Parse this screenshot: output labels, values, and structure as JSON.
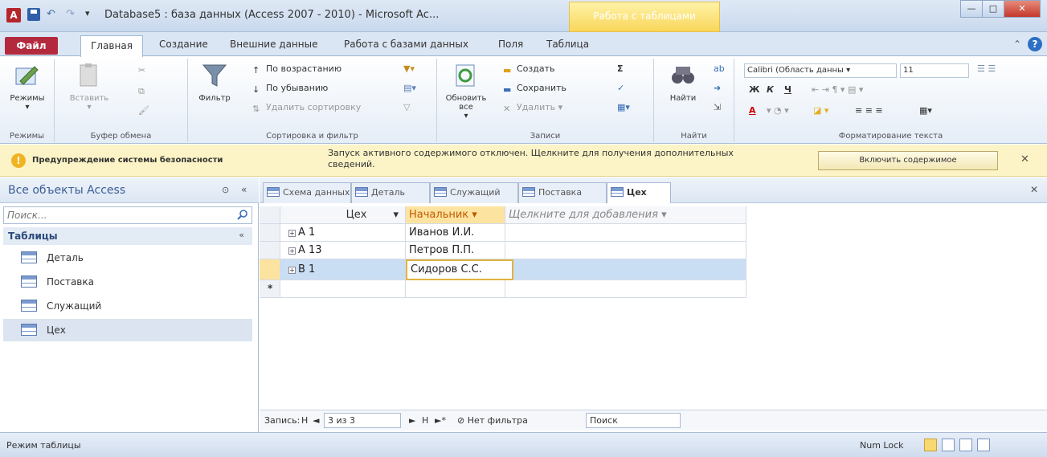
{
  "window": {
    "title": "Database5 : база данных (Access 2007 - 2010) - Microsoft Ac...",
    "context_group": "Работа с таблицами",
    "app_icon_letter": "A",
    "controls": {
      "minimize": "—",
      "maximize": "□",
      "close": "✕"
    }
  },
  "tabs": {
    "file": "Файл",
    "home": "Главная",
    "create": "Создание",
    "external": "Внешние данные",
    "dbtools": "Работа с базами данных",
    "fields": "Поля",
    "table": "Таблица"
  },
  "ribbon": {
    "views": {
      "button": "Режимы",
      "group": "Режимы"
    },
    "clipboard": {
      "paste": "Вставить",
      "group": "Буфер обмена"
    },
    "sort": {
      "filter": "Фильтр",
      "asc": "По возрастанию",
      "desc": "По убыванию",
      "clear": "Удалить сортировку",
      "group": "Сортировка и фильтр"
    },
    "records": {
      "refresh": "Обновить все",
      "new": "Создать",
      "save": "Сохранить",
      "delete": "Удалить",
      "totals": "Σ",
      "group": "Записи"
    },
    "find": {
      "find": "Найти",
      "group": "Найти"
    },
    "format": {
      "font": "Calibri (Область данны",
      "size": "11",
      "bold": "Ж",
      "italic": "К",
      "underline": "Ч",
      "font_color": "A",
      "group": "Форматирование текста"
    }
  },
  "security": {
    "title": "Предупреждение системы безопасности",
    "message": "Запуск активного содержимого отключен. Щелкните для получения дополнительных сведений.",
    "enable": "Включить содержимое",
    "close": "✕"
  },
  "nav": {
    "title": "Все объекты Access",
    "search_placeholder": "Поиск...",
    "group": "Таблицы",
    "items": [
      "Деталь",
      "Поставка",
      "Служащий",
      "Цех"
    ],
    "selected_index": 3
  },
  "doc_tabs": [
    "Схема данных",
    "Деталь",
    "Служащий",
    "Поставка",
    "Цех"
  ],
  "active_doc_tab": "Цех",
  "datasheet": {
    "columns": [
      "Цех",
      "Начальник",
      "Щелкните для добавления"
    ],
    "rows": [
      {
        "shop": "A 1",
        "chief": "Иванов И.И."
      },
      {
        "shop": "A 13",
        "chief": "Петров П.П."
      },
      {
        "shop": "B 1",
        "chief": "Сидоров С.С."
      }
    ],
    "new_row_marker": "*"
  },
  "record_nav": {
    "label": "Запись:",
    "first": "H",
    "prev": "◄",
    "position": "3 из 3",
    "next": "►",
    "last": "H",
    "new": "►*",
    "filter": "Нет фильтра",
    "search": "Поиск"
  },
  "status": {
    "mode": "Режим таблицы",
    "num_lock": "Num Lock"
  }
}
